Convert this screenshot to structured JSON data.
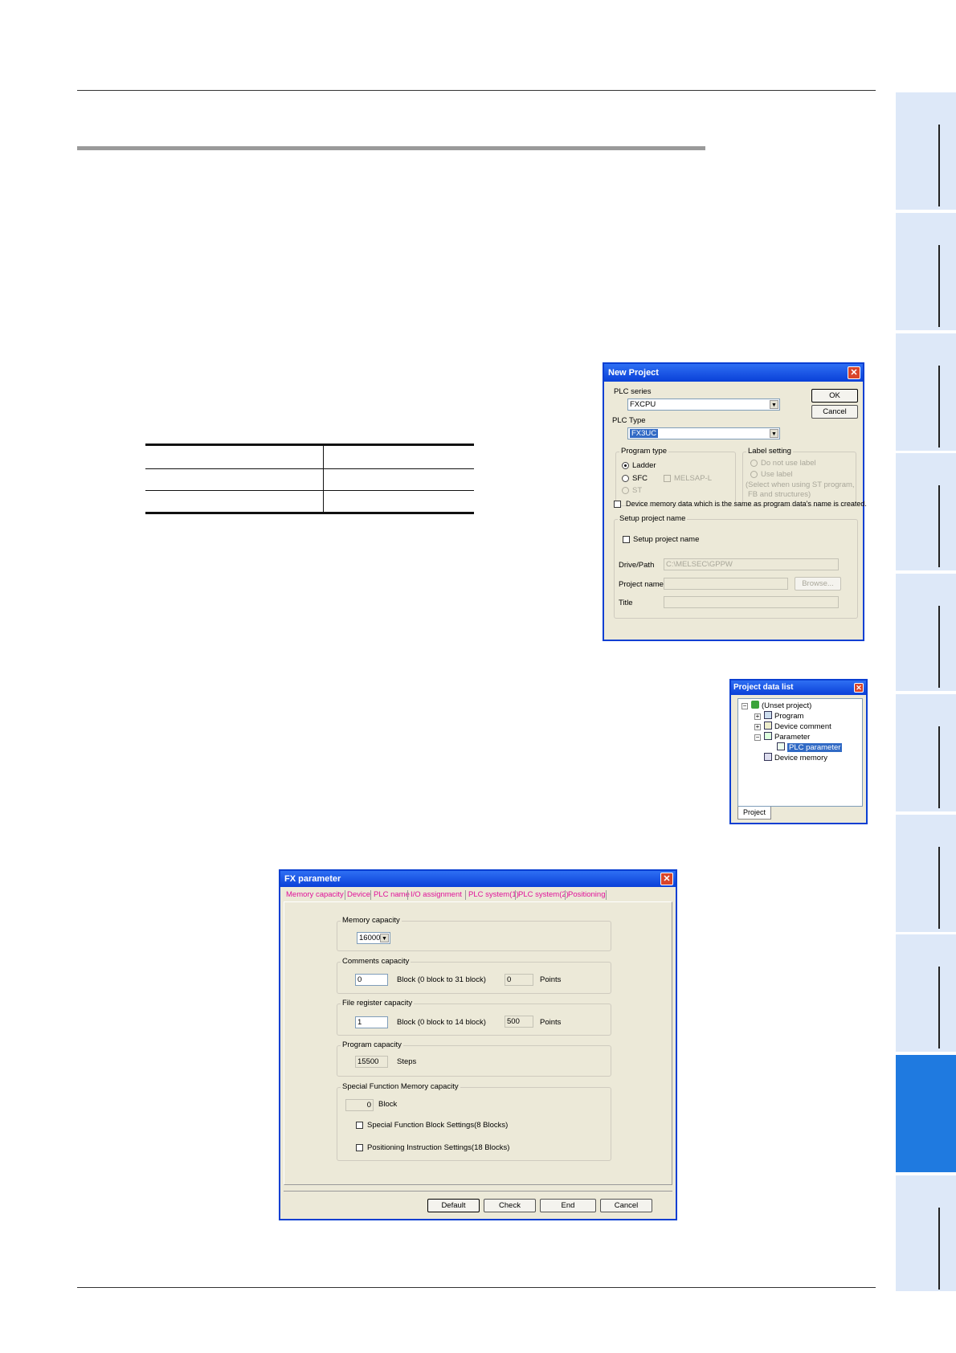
{
  "side_tabs": {
    "count": 10,
    "active_index": 8
  },
  "table": {
    "rows": [
      [
        "",
        ""
      ],
      [
        "",
        ""
      ],
      [
        "",
        ""
      ]
    ]
  },
  "new_project": {
    "title": "New Project",
    "plc_series_label": "PLC series",
    "plc_series_value": "FXCPU",
    "plc_type_label": "PLC Type",
    "plc_type_value": "FX3UC",
    "ok": "OK",
    "cancel": "Cancel",
    "program_type_label": "Program type",
    "ladder": "Ladder",
    "sfc": "SFC",
    "melsap": "MELSAP-L",
    "st": "ST",
    "label_setting_label": "Label setting",
    "no_label": "Do not use label",
    "use_label": "Use label",
    "label_hint_1": "(Select when using ST program,",
    "label_hint_2": "FB and structures)",
    "device_memory_check": "Device memory data which is the same as program data's name is created.",
    "setup_group_label": "Setup project name",
    "setup_check": "Setup project name",
    "drive_path_label": "Drive/Path",
    "drive_path_value": "C:\\MELSEC\\GPPW",
    "project_name_label": "Project name",
    "browse": "Browse...",
    "title_label": "Title"
  },
  "project_list": {
    "title": "Project data list",
    "root": "(Unset project)",
    "program": "Program",
    "device_comment": "Device comment",
    "parameter": "Parameter",
    "plc_parameter": "PLC parameter",
    "device_memory": "Device memory",
    "tab": "Project"
  },
  "fx_parameter": {
    "title": "FX parameter",
    "tabs": [
      "Memory capacity",
      "Device",
      "PLC name",
      "I/O assignment",
      "PLC system(1)",
      "PLC system(2)",
      "Positioning"
    ],
    "memory_capacity_label": "Memory capacity",
    "memory_capacity_value": "16000",
    "comments_label": "Comments capacity",
    "comments_value": "0",
    "comments_block": "Block (0 block to 31 block)",
    "comments_points": "0",
    "points": "Points",
    "file_reg_label": "File register capacity",
    "file_reg_value": "1",
    "file_reg_block": "Block (0 block to 14 block)",
    "file_reg_points": "500",
    "program_label": "Program capacity",
    "program_value": "15500",
    "steps": "Steps",
    "special_label": "Special Function Memory capacity",
    "special_value": "0",
    "block": "Block",
    "special_check_1": "Special Function Block Settings(8 Blocks)",
    "special_check_2": "Positioning Instruction Settings(18 Blocks)",
    "default": "Default",
    "check": "Check",
    "end": "End",
    "cancel": "Cancel"
  }
}
